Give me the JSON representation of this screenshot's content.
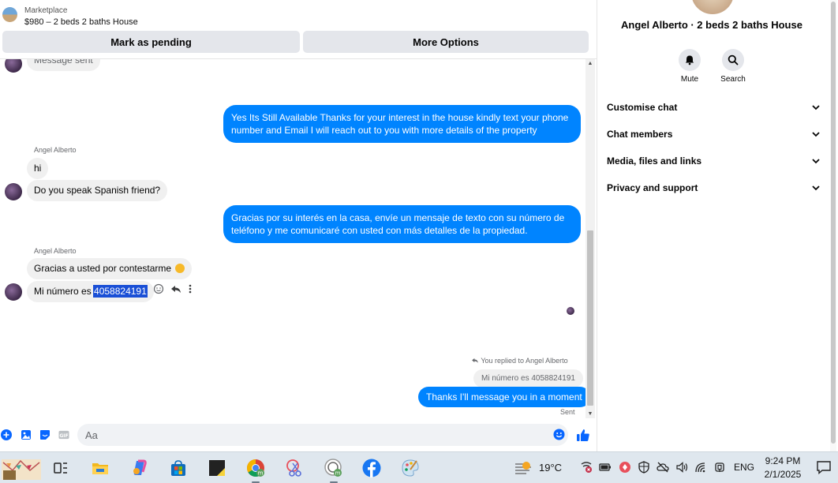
{
  "topbar": {
    "marketplace_label": "Marketplace",
    "listing": "$980 – 2 beds 2 baths House",
    "pending_label": "Mark as pending",
    "more_label": "More Options"
  },
  "messages": {
    "truncated_top": "Message sent",
    "out1": "Yes Its Still Available Thanks for your interest in the house kindly text your phone number and Email I will reach out to you with more details of the property",
    "sender1": "Angel Alberto",
    "in_hi": "hi",
    "in_spanish": "Do you speak Spanish friend?",
    "out2": "Gracias por su interés en la casa, envíe un mensaje de texto con su número de teléfono y me comunicaré con usted con más detalles de la propiedad.",
    "sender2": "Angel Alberto",
    "in_gracias": "Gracias a usted por contestarme",
    "in_numero_prefix": "Mi número es ",
    "in_numero_value": "4058824191",
    "replied_label": "You replied to Angel Alberto",
    "reply_quote": "Mi número es 4058824191",
    "out3": "Thanks I'll message you in a moment",
    "sent_label": "Sent"
  },
  "composer": {
    "placeholder": "Aa"
  },
  "sidebar": {
    "title": "Angel Alberto · 2 beds 2 baths House",
    "mute_label": "Mute",
    "search_label": "Search",
    "items": [
      {
        "label": "Customise chat"
      },
      {
        "label": "Chat members"
      },
      {
        "label": "Media, files and links"
      },
      {
        "label": "Privacy and support"
      }
    ]
  },
  "taskbar": {
    "temperature": "19°C",
    "language": "ENG",
    "time": "9:24 PM",
    "date": "2/1/2025"
  },
  "colors": {
    "outgoing_bubble": "#0084ff",
    "incoming_bubble": "#f0f0f0",
    "accent": "#0866ff",
    "selection": "#1a4fd6"
  }
}
